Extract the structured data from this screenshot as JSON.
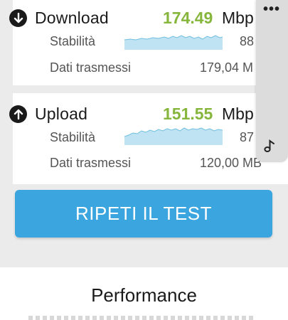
{
  "download": {
    "title": "Download",
    "speed": "174.49",
    "unit": "Mbp",
    "stability_label": "Stabilità",
    "stability_value": "88",
    "data_label": "Dati trasmessi",
    "data_value": "179,04 M"
  },
  "upload": {
    "title": "Upload",
    "speed": "151.55",
    "unit": "Mbp",
    "stability_label": "Stabilità",
    "stability_value": "87",
    "data_label": "Dati trasmessi",
    "data_value": "120,00 MB"
  },
  "side_panel": {
    "menu_icon": "more-dots-icon",
    "note_icon": "music-note-icon"
  },
  "repeat_button": {
    "label": "RIPETI IL TEST"
  },
  "performance": {
    "title": "Performance"
  },
  "colors": {
    "speed": "#86b63c",
    "button": "#3aa5de",
    "spark_fill": "#bfe3f2",
    "spark_line": "#6fbfe0"
  }
}
